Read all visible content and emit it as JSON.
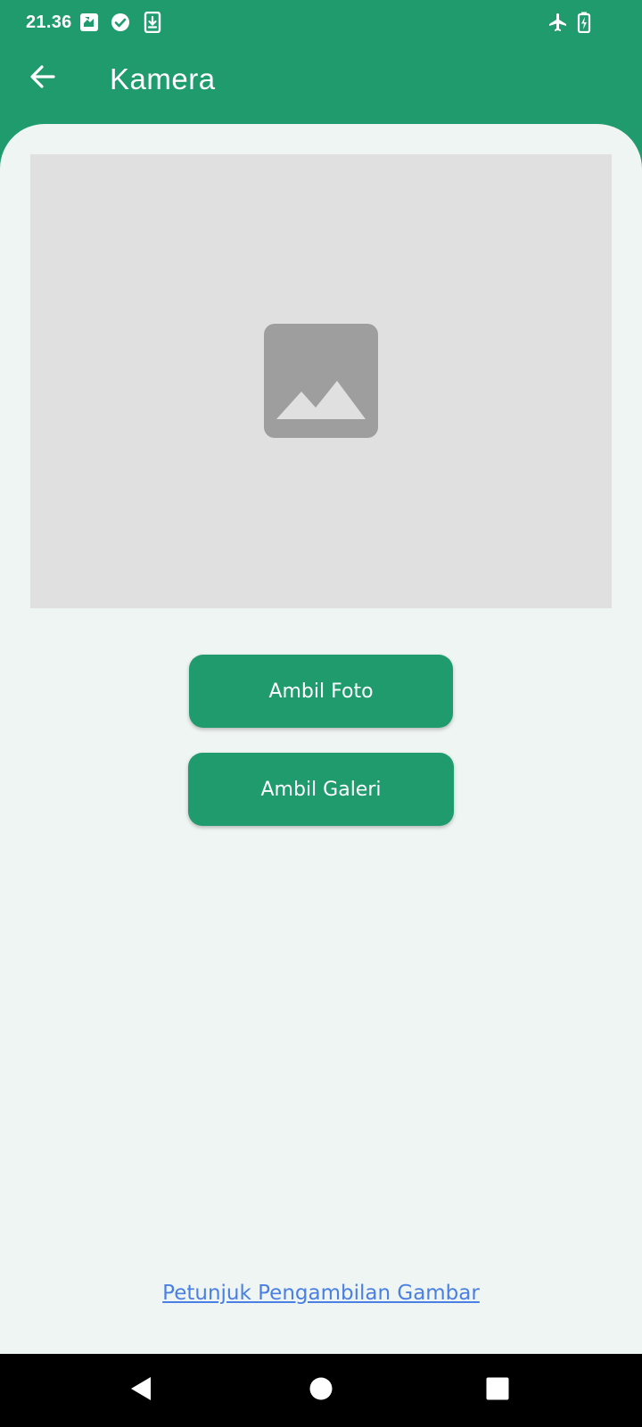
{
  "status_bar": {
    "time": "21.36",
    "icons": [
      "photo-sync-icon",
      "check-circle-icon",
      "download-icon",
      "airplane-mode-icon",
      "battery-charging-icon"
    ]
  },
  "app_bar": {
    "back_icon": "arrow-back-icon",
    "title": "Kamera"
  },
  "image_preview": {
    "placeholder_icon": "image-placeholder-icon"
  },
  "actions": {
    "take_photo_label": "Ambil Foto",
    "gallery_label": "Ambil Galeri"
  },
  "footer": {
    "guide_link": "Petunjuk Pengambilan Gambar"
  },
  "nav_bar": {
    "icons": [
      "nav-back-icon",
      "nav-home-icon",
      "nav-recents-icon"
    ]
  },
  "colors": {
    "primary": "#1f9b6e",
    "background": "#eff5f3",
    "preview_bg": "#e0e0e0",
    "placeholder_icon": "#9e9e9e",
    "link": "#4a7fe3",
    "nav_bar": "#000000"
  }
}
